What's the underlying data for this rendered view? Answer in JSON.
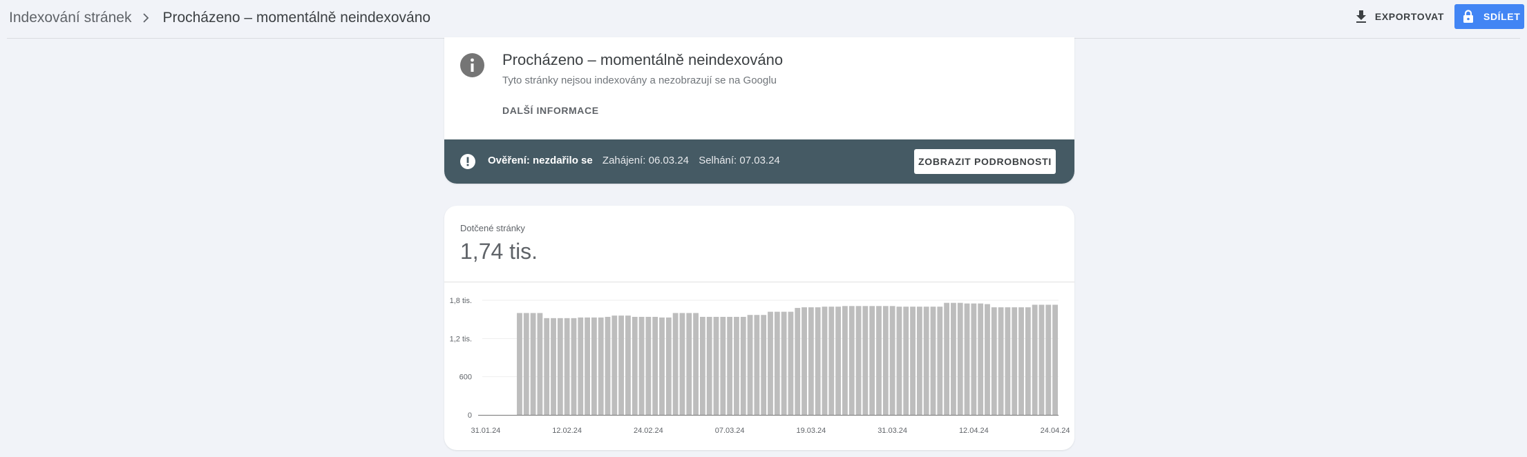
{
  "breadcrumb": {
    "parent": "Indexování stránek",
    "current": "Procházeno – momentálně neindexováno"
  },
  "toolbar": {
    "export_label": "EXPORTOVAT",
    "share_label": "SDÍLET"
  },
  "info": {
    "title": "Procházeno – momentálně neindexováno",
    "subtitle": "Tyto stránky nejsou indexovány a nezobrazují se na Googlu",
    "more_label": "DALŠÍ INFORMACE"
  },
  "validation": {
    "status": "Ověření: nezdařilo se",
    "started": "Zahájení: 06.03.24",
    "failed": "Selhání: 07.03.24",
    "details_label": "ZOBRAZIT PODROBNOSTI"
  },
  "metric": {
    "label": "Dotčené stránky",
    "value": "1,74 tis."
  },
  "colors": {
    "accent": "#4285f4",
    "banner": "#455a64",
    "bar": "#bdbdbd",
    "icon": "#757575"
  },
  "icons": {
    "export": "download-icon",
    "share": "lock-icon",
    "info": "info-icon",
    "validation": "error-icon",
    "breadcrumb_sep": "chevron-right-icon"
  },
  "chart_data": {
    "type": "bar",
    "ylim": [
      0,
      1800
    ],
    "yticks": [
      0,
      600,
      1200,
      1800
    ],
    "ytick_labels": [
      "0",
      "600",
      "1,2 tis.",
      "1,8 tis."
    ],
    "xtick_labels": [
      "31.01.24",
      "12.02.24",
      "24.02.24",
      "07.03.24",
      "19.03.24",
      "31.03.24",
      "12.04.24",
      "24.04.24"
    ],
    "xtick_indices": [
      0,
      12,
      24,
      36,
      48,
      60,
      72,
      84
    ],
    "values": [
      null,
      null,
      null,
      null,
      null,
      1600,
      1600,
      1600,
      1600,
      1520,
      1520,
      1520,
      1520,
      1520,
      1530,
      1530,
      1530,
      1530,
      1540,
      1560,
      1560,
      1560,
      1540,
      1540,
      1540,
      1540,
      1530,
      1530,
      1600,
      1600,
      1600,
      1600,
      1540,
      1540,
      1540,
      1540,
      1540,
      1540,
      1540,
      1570,
      1570,
      1570,
      1620,
      1620,
      1620,
      1620,
      1680,
      1690,
      1690,
      1690,
      1700,
      1700,
      1700,
      1710,
      1710,
      1710,
      1710,
      1710,
      1710,
      1710,
      1710,
      1700,
      1700,
      1700,
      1700,
      1700,
      1700,
      1700,
      1760,
      1760,
      1760,
      1750,
      1750,
      1750,
      1740,
      1690,
      1690,
      1690,
      1690,
      1690,
      1690,
      1730,
      1730,
      1730,
      1730
    ]
  }
}
